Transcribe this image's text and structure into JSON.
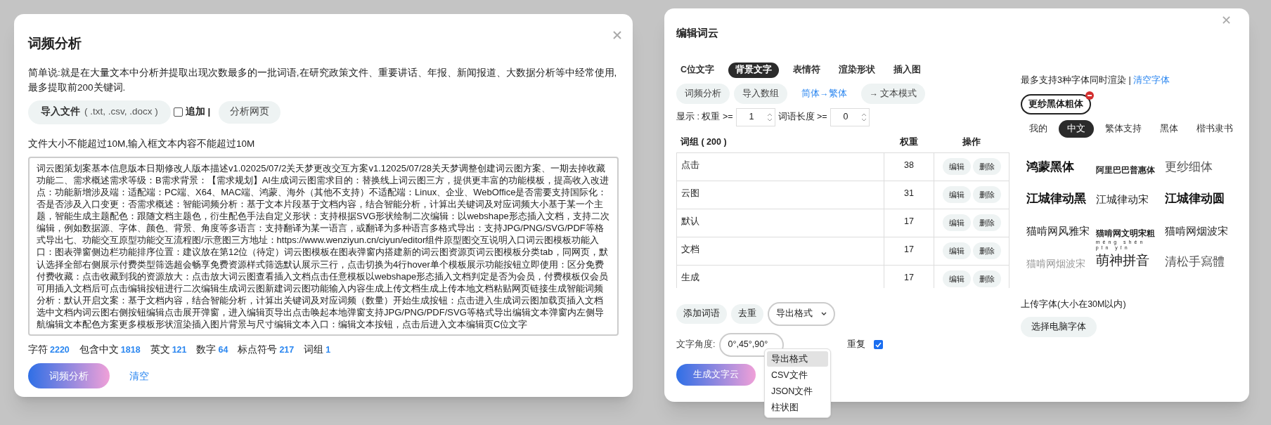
{
  "word_freq_dialog": {
    "title": "词频分析",
    "description": "简单说:就是在大量文本中分析并提取出现次数最多的一批词语,在研究政策文件、重要讲话、年报、新闻报道、大数据分析等中经常使用,最多提取前200关键词.",
    "import_button": {
      "label": "导入文件",
      "hint": "( .txt,  .csv,  .docx )"
    },
    "append_checkbox": {
      "label": "追加 |",
      "checked": false
    },
    "analyze_web_button": "分析网页",
    "size_note": "文件大小不能超过10M,输入框文本内容不能超过10M",
    "text_input": {
      "value": "词云图策划案基本信息版本日期修改人版本描述v1.02025/07/2关天梦更改交互方案v1.12025/07/28关天梦调整创建词云图方案、一期去掉收藏功能二、需求概述需求等级：B需求背景：【需求规划】AI生成词云图需求目的：替换线上词云图三方，提供更丰富的功能模板，提高收入改进点：功能新增涉及端：适配端：PC端、X64、MAC端、鸿蒙、海外（其他不支持）不适配端：Linux、企业、WebOffice是否需要支持国际化：否是否涉及入口变更：否需求概述：智能词频分析：基于文本片段基于文档内容，结合智能分析，计算出关键词及对应词频大小基于某一个主题，智能生成主题配色：跟随文档主题色，衍生配色手法自定义形状：支持根据SVG形状绘制二次编辑：以webshape形态插入文档，支持二次编辑，例如数据源、字体、颜色、背景、角度等多语言：支持翻译为某一语言，或翻译为多种语言多格式导出：支持JPG/PNG/SVG/PDF等格式导出七、功能交互原型功能交互流程图/示意图三方地址：https://www.wenziyun.cn/ciyun/editor组件原型图交互说明入口词云图模板功能入口：图表弹窗侧边栏功能排序位置：建议放在第12位（待定）词云图模板在图表弹窗内搭建新的词云图资源页词云图模板分类tab，同网页，默认选择全部右侧展示付费类型筛选超会畅享免费资源样式筛选默认展示三行，点击切换为4行hover单个模板展示功能按钮立即使用：区分免费付费收藏：点击收藏到我的资源放大：点击放大词云图查看插入文档点击任意模板以webshape形态插入文档判定是否为会员，付费模板仅会员可用插入文档后可点击编辑按钮进行二次编辑生成词云图新建词云图功能输入内容生成上传文档生成上传本地文档粘贴网页链接生成智能词频分析：默认开启文案：基于文档内容，结合智能分析，计算出关键词及对应词频（数量）开始生成按钮：点击进入生成词云图加载页插入文档选中文档内词云图右侧按钮编辑点击展开弹窗，进入编辑页导出点击唤起本地弹窗支持JPG/PNG/PDF/SVG等格式导出编辑文本弹窗内左侧导航编辑文本配色方案更多模板形状渲染插入图片背景与尺寸编辑文本入口：编辑文本按钮，点击后进入文本编辑页C位文字"
    },
    "stats": [
      {
        "label": "字符",
        "value": "2220"
      },
      {
        "label": "包含中文",
        "value": "1818"
      },
      {
        "label": "英文",
        "value": "121"
      },
      {
        "label": "数字",
        "value": "64"
      },
      {
        "label": "标点符号",
        "value": "217"
      },
      {
        "label": "词组",
        "value": "1"
      }
    ],
    "analyze_button": "词频分析",
    "clear_link": "清空"
  },
  "edit_dialog": {
    "title": "编辑词云",
    "tabs": [
      {
        "label": "C位文字",
        "selected": false
      },
      {
        "label": "背景文字",
        "selected": true
      },
      {
        "label": "表情符",
        "selected": false
      },
      {
        "label": "渲染形状",
        "selected": false
      },
      {
        "label": "插入图",
        "selected": false
      }
    ],
    "actions": [
      {
        "label": "词频分析",
        "kind": "button"
      },
      {
        "label": "导入数组",
        "kind": "button"
      },
      {
        "label": "简体→繁体",
        "kind": "link"
      },
      {
        "label": "→ 文本模式",
        "kind": "button"
      }
    ],
    "filter": {
      "weight_label": "显示 : 权重 >=",
      "weight_value": "1",
      "length_label": "词语长度 >=",
      "length_value": "0"
    },
    "table": {
      "columns": [
        "词组 ( 200 )",
        "权重",
        "操作"
      ],
      "rows": [
        {
          "word": "点击",
          "weight": "38",
          "edit": "编辑",
          "delete": "删除"
        },
        {
          "word": "云图",
          "weight": "31",
          "edit": "编辑",
          "delete": "删除"
        },
        {
          "word": "默认",
          "weight": "17",
          "edit": "编辑",
          "delete": "删除"
        },
        {
          "word": "文档",
          "weight": "17",
          "edit": "编辑",
          "delete": "删除"
        },
        {
          "word": "生成",
          "weight": "17",
          "edit": "编辑",
          "delete": "删除"
        }
      ]
    },
    "add_word_button": "添加词语",
    "dedupe_button": "去重",
    "export_select": {
      "value": "导出格式",
      "expanded": true,
      "options": [
        {
          "label": "导出格式",
          "selected": true
        },
        {
          "label": "CSV文件",
          "selected": false
        },
        {
          "label": "JSON文件",
          "selected": false
        },
        {
          "label": "柱状图",
          "selected": false
        }
      ]
    },
    "angle": {
      "label": "文字角度:",
      "value": "0°,45°,90°"
    },
    "repeat": {
      "label": "重复",
      "checked": true
    },
    "generate_button": "生成文字云",
    "font_panel": {
      "note": "最多支持3种字体同时渲染 |",
      "clear_link": "清空字体",
      "chosen_fonts": [
        "更纱黑体粗体"
      ],
      "tabs": [
        {
          "label": "我的",
          "selected": false
        },
        {
          "label": "中文",
          "selected": true
        },
        {
          "label": "繁体支持",
          "selected": false
        },
        {
          "label": "黑体",
          "selected": false
        },
        {
          "label": "楷书隶书",
          "selected": false
        }
      ],
      "fonts": [
        {
          "name": "鸿蒙黑体",
          "kind": "heavy"
        },
        {
          "name": "阿里巴巴普惠体",
          "kind": "bold"
        },
        {
          "name": "更纱细体",
          "kind": "light"
        },
        {
          "name": "江城律动黑",
          "kind": "heavy"
        },
        {
          "name": "江城律动宋",
          "kind": "serif"
        },
        {
          "name": "江城律动圆",
          "kind": "heavy"
        },
        {
          "name": "猫啃网风雅宋",
          "kind": "serif"
        },
        {
          "name": "猫啃网文明宋粗",
          "kind": "boldserif"
        },
        {
          "name": "猫啃网烟波宋",
          "kind": "serif"
        },
        {
          "name": "猫啃网烟波宋",
          "kind": "faint"
        },
        {
          "name": "萌神拼音",
          "kind": "pinyin",
          "annotation": "méng shén pīn yīn"
        },
        {
          "name": "清松手寫體",
          "kind": "light"
        }
      ],
      "upload_label": "上传字体(大小在30M以内)",
      "upload_button": "选择电脑字体"
    }
  }
}
